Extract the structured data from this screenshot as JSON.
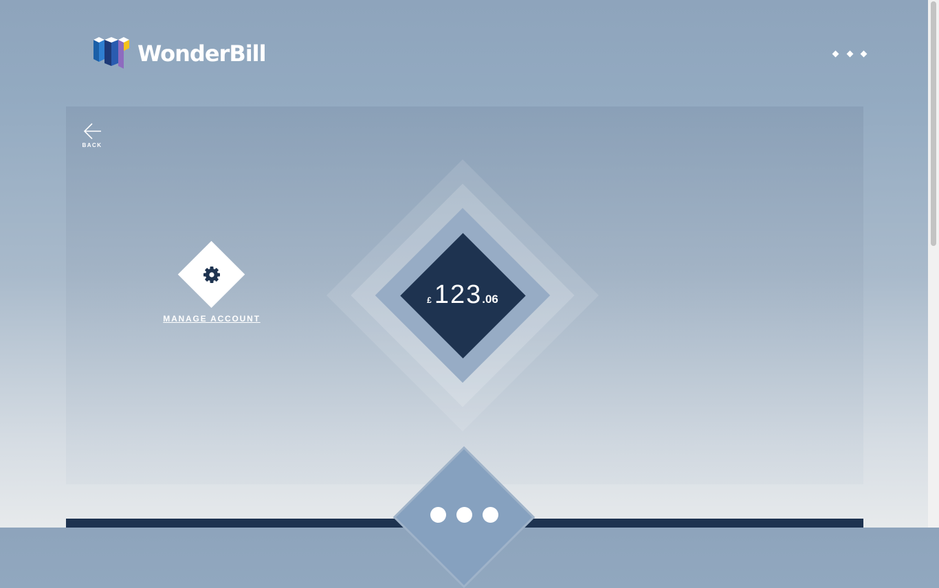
{
  "header": {
    "brand_name": "WonderBill",
    "logo_icon": "wonderbill-cube-logo",
    "menu_icon": "more-dots-icon"
  },
  "navigation": {
    "back_label": "BACK",
    "back_icon": "arrow-left-icon"
  },
  "balance": {
    "currency_symbol": "£",
    "whole": "123",
    "pence": ".06"
  },
  "manage_account": {
    "label": "MANAGE ACCOUNT",
    "icon": "gear-icon"
  },
  "pager": {
    "dots": 3
  },
  "colors": {
    "navy": "#1e3350",
    "accent_blue": "#86a1bf",
    "logo_blue": "#1b5fa8",
    "logo_yellow": "#f5c21b",
    "logo_purple": "#8e6bbf"
  }
}
